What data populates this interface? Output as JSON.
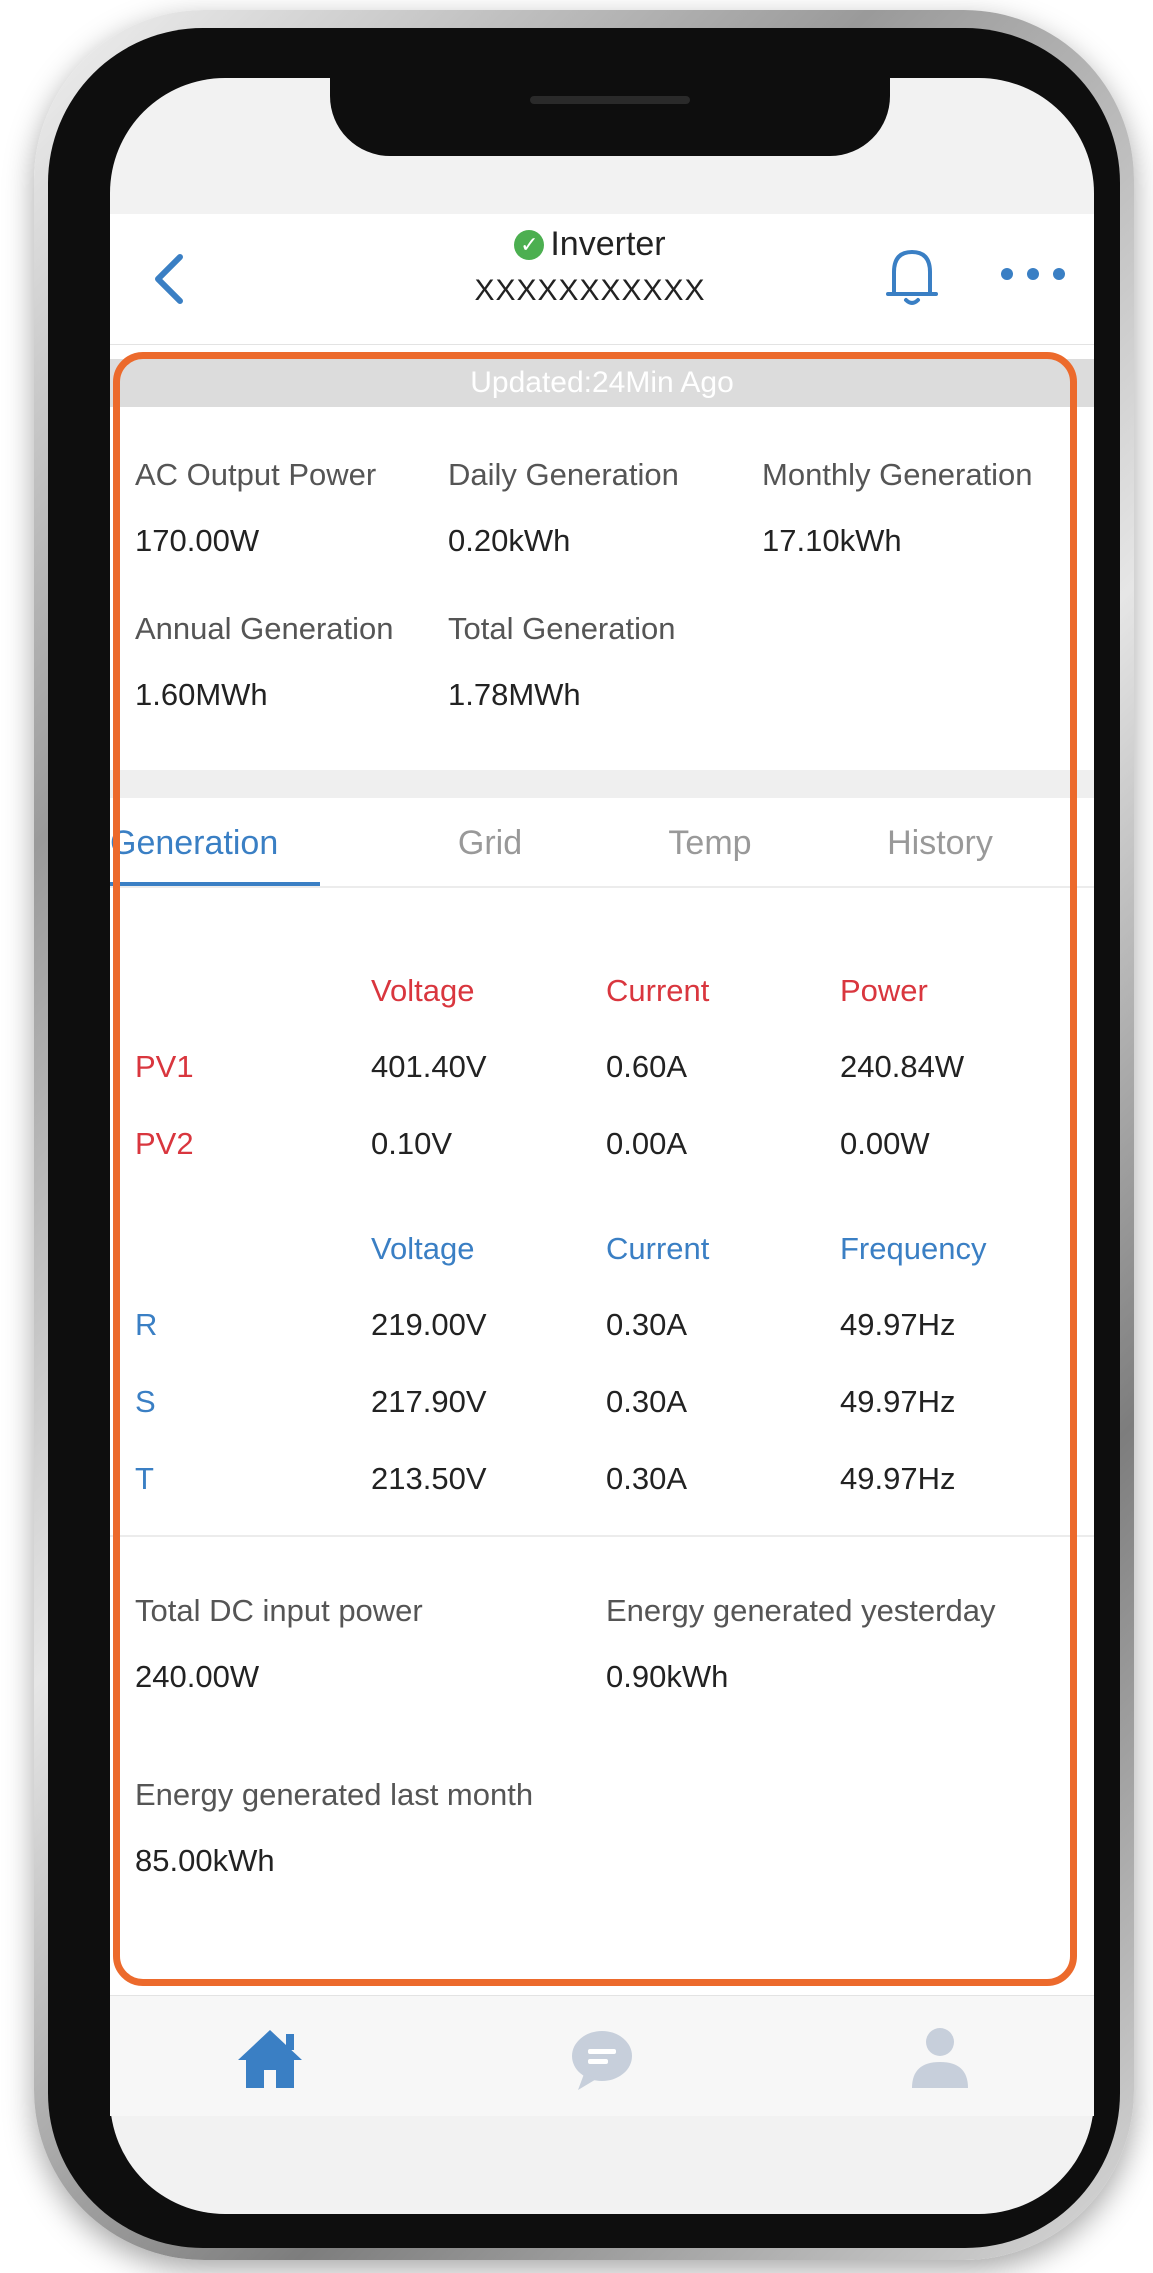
{
  "header": {
    "title": "Inverter",
    "serial": "XXXXXXXXXXX",
    "status": "online"
  },
  "updated": "Updated:24Min Ago",
  "summary": [
    {
      "label": "AC Output Power",
      "value": "170.00W"
    },
    {
      "label": "Daily Generation",
      "value": "0.20kWh"
    },
    {
      "label": "Monthly Generation",
      "value": "17.10kWh"
    },
    {
      "label": "Annual Generation",
      "value": "1.60MWh"
    },
    {
      "label": "Total Generation",
      "value": "1.78MWh"
    }
  ],
  "tabs": [
    {
      "label": "Generation",
      "active": true
    },
    {
      "label": "Grid",
      "active": false
    },
    {
      "label": "Temp",
      "active": false
    },
    {
      "label": "History",
      "active": false
    }
  ],
  "pv_table": {
    "headers": [
      "Voltage",
      "Current",
      "Power"
    ],
    "rows": [
      {
        "name": "PV1",
        "voltage": "401.40V",
        "current": "0.60A",
        "power": "240.84W"
      },
      {
        "name": "PV2",
        "voltage": "0.10V",
        "current": "0.00A",
        "power": "0.00W"
      }
    ]
  },
  "grid_table": {
    "headers": [
      "Voltage",
      "Current",
      "Frequency"
    ],
    "rows": [
      {
        "name": "R",
        "voltage": "219.00V",
        "current": "0.30A",
        "frequency": "49.97Hz"
      },
      {
        "name": "S",
        "voltage": "217.90V",
        "current": "0.30A",
        "frequency": "49.97Hz"
      },
      {
        "name": "T",
        "voltage": "213.50V",
        "current": "0.30A",
        "frequency": "49.97Hz"
      }
    ]
  },
  "extra_stats": [
    {
      "label": "Total DC input power",
      "value": "240.00W"
    },
    {
      "label": "Energy generated yesterday",
      "value": "0.90kWh"
    },
    {
      "label": "Energy generated last month",
      "value": "85.00kWh"
    }
  ],
  "nav": [
    "home-icon",
    "message-icon",
    "user-icon"
  ],
  "colors": {
    "accent": "#3a7fc4",
    "pv_header": "#d9363e",
    "highlight_border": "#ec6a2c",
    "status_ok": "#4caf50"
  }
}
